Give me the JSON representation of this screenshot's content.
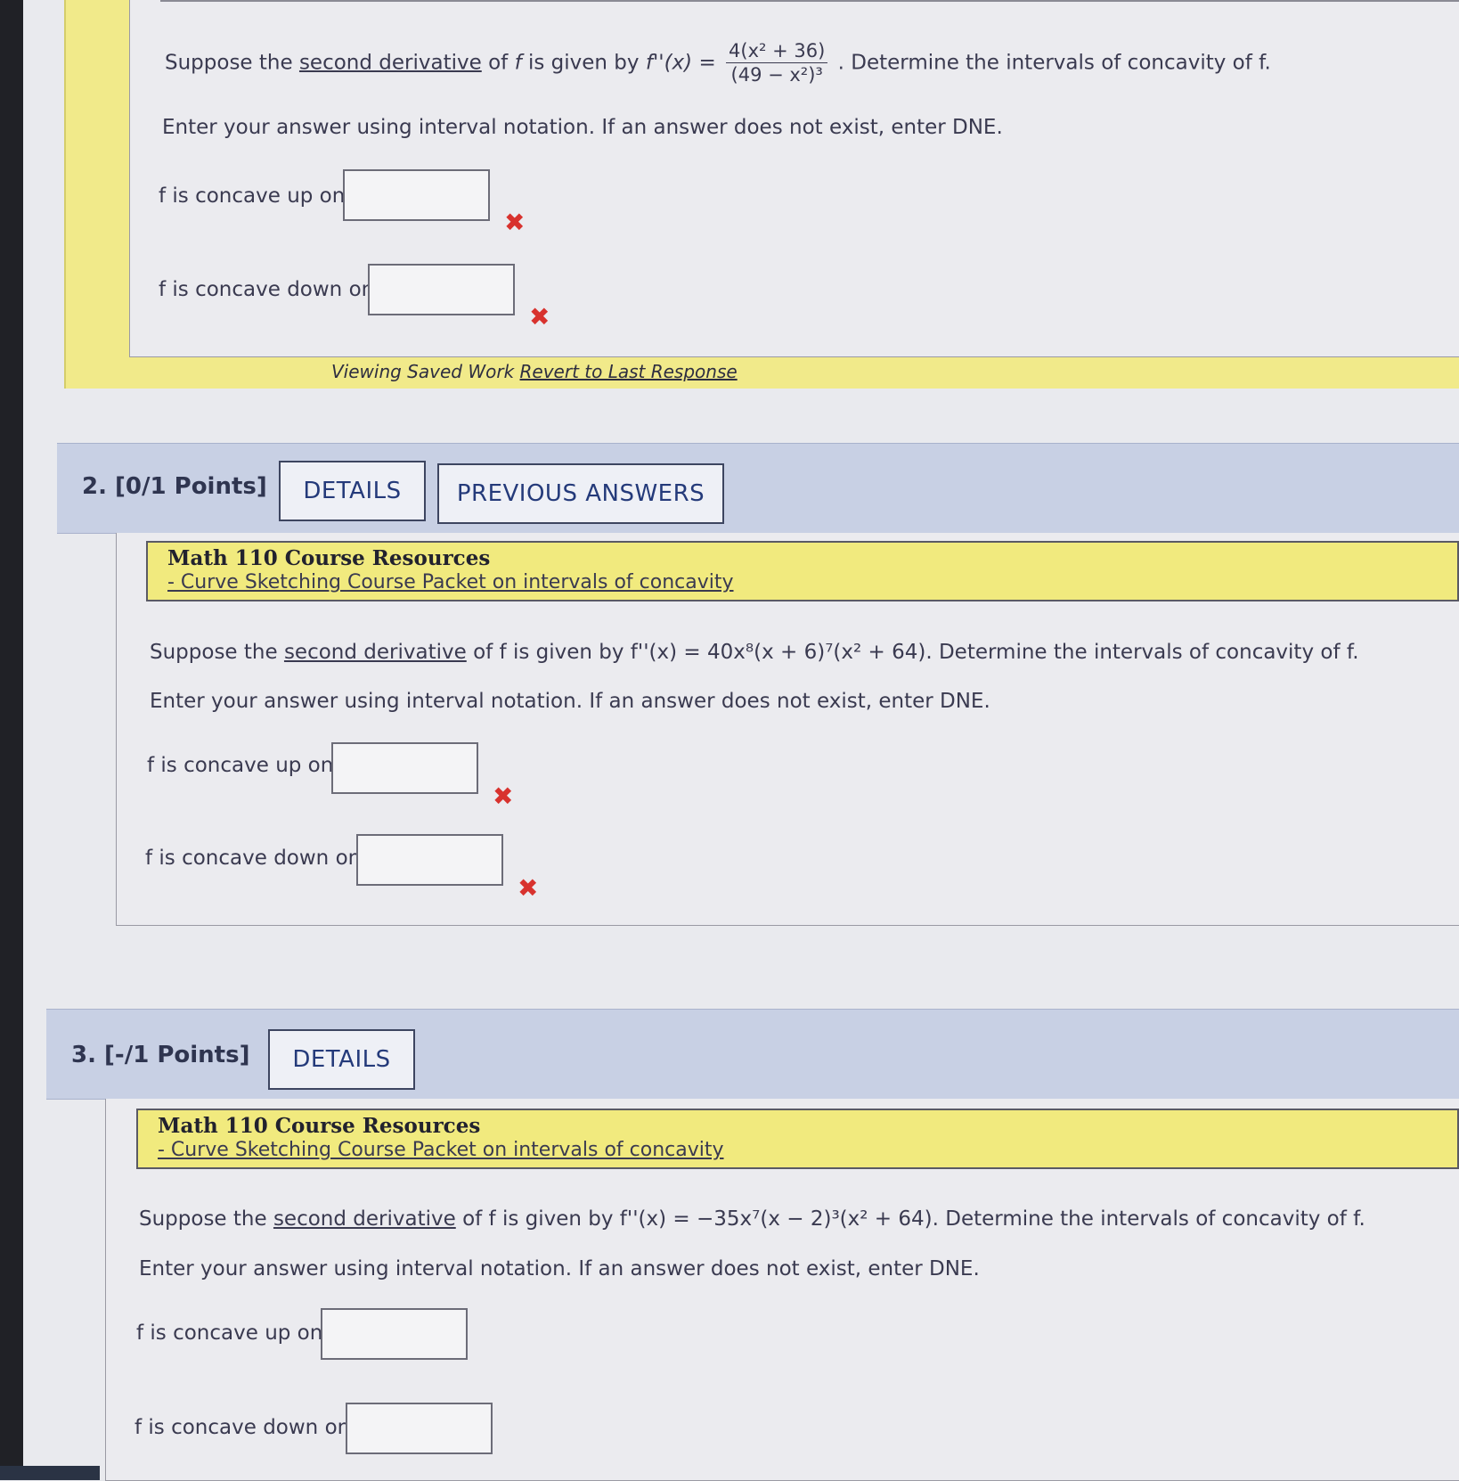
{
  "q1": {
    "prompt_pre": "Suppose the",
    "prompt_link": "second derivative",
    "prompt_mid": "of",
    "f_symbol": "f",
    "prompt_mid2": "is given by",
    "fpp": "f''(x) =",
    "num": "4(x² + 36)",
    "den": "(49 − x²)³",
    "prompt_post": ". Determine the intervals of concavity of f.",
    "instructions": "Enter your answer using interval notation. If an answer does not exist, enter DNE.",
    "up_label": "f is concave up on",
    "down_label": "f is concave down on",
    "up_value": "",
    "down_value": "",
    "saved_text": "Viewing Saved Work",
    "revert_link": "Revert to Last Response"
  },
  "q2": {
    "number": "2.",
    "points": "[0/1 Points]",
    "details_btn": "DETAILS",
    "prev_btn": "PREVIOUS ANSWERS",
    "res_title": "Math 110 Course Resources",
    "res_link": "- Curve Sketching Course Packet on intervals of concavity",
    "prompt_pre": "Suppose the",
    "prompt_link": "second derivative",
    "prompt_post": "of f is given by f''(x) = 40x⁸(x + 6)⁷(x² + 64). Determine the intervals of concavity of f.",
    "instructions": "Enter your answer using interval notation. If an answer does not exist, enter DNE.",
    "up_label": "f is concave up on",
    "down_label": "f is concave down on",
    "up_value": "",
    "down_value": ""
  },
  "q3": {
    "number": "3.",
    "points": "[-/1 Points]",
    "details_btn": "DETAILS",
    "res_title": "Math 110 Course Resources",
    "res_link": "- Curve Sketching Course Packet on intervals of concavity",
    "prompt_pre": "Suppose the",
    "prompt_link": "second derivative",
    "prompt_post": "of f is given by f''(x) = −35x⁷(x − 2)³(x² + 64). Determine the intervals of concavity of f.",
    "instructions": "Enter your answer using interval notation. If an answer does not exist, enter DNE.",
    "up_label": "f is concave up on",
    "down_label": "f is concave down on",
    "up_value": "",
    "down_value": ""
  },
  "icons": {
    "incorrect": "x-mark-icon",
    "incorrect_glyph": "✖",
    "incorrect_color": "#d8322e"
  },
  "colors": {
    "resource_bg": "#f1ea7e",
    "header_bg": "#c8d0e4",
    "button_text": "#243a7a"
  }
}
